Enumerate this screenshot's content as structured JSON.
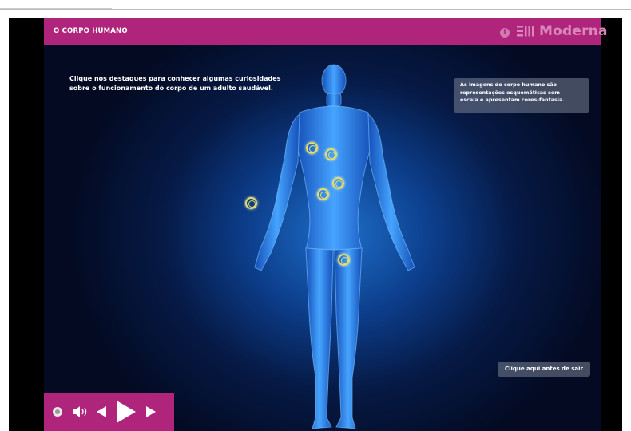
{
  "header": {
    "title": "O CORPO HUMANO",
    "info_label": "i",
    "brand_name": "Moderna"
  },
  "intro": {
    "line1": "Clique nos destaques para conhecer algumas curiosidades",
    "line2": "sobre o funcionamento do corpo de um adulto saudável."
  },
  "notice": {
    "line1": "As imagens do corpo humano são",
    "line2": "representações esquemáticas sem",
    "line3": "escala e apresentam cores-fantasia."
  },
  "exit_button": {
    "label": "Clique aqui antes de sair"
  },
  "hotspots": [
    {
      "name": "hotspot-heart"
    },
    {
      "name": "hotspot-lung"
    },
    {
      "name": "hotspot-liver"
    },
    {
      "name": "hotspot-stomach"
    },
    {
      "name": "hotspot-arm"
    },
    {
      "name": "hotspot-thigh"
    }
  ],
  "controls": [
    "record-icon",
    "audio-icon",
    "previous-icon",
    "play-icon",
    "next-icon"
  ],
  "colors": {
    "header_bg": "#b0257c",
    "brand_pink": "#d887bb",
    "hotspot_ring": "#e4dd6a",
    "body_glow": "#2f8ef0"
  }
}
